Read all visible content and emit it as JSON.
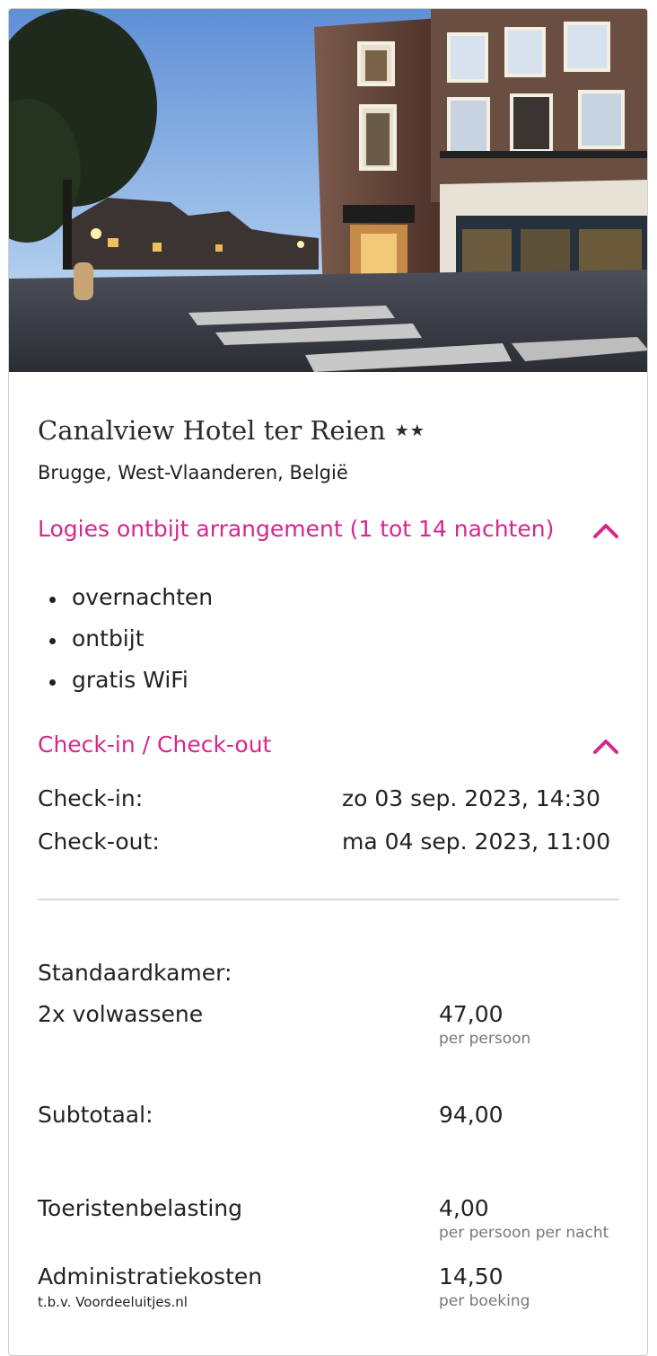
{
  "hotel": {
    "name": "Canalview Hotel ter Reien",
    "stars": "★★",
    "location": "Brugge, West-Vlaanderen, België"
  },
  "package": {
    "title": "Logies ontbijt arrangement (1 tot 14 nachten)",
    "features": [
      "overnachten",
      "ontbijt",
      "gratis WiFi"
    ]
  },
  "checkin": {
    "title": "Check-in / Check-out",
    "checkin_label": "Check-in:",
    "checkin_value": "zo 03 sep. 2023, 14:30",
    "checkout_label": "Check-out:",
    "checkout_value": "ma 04 sep. 2023, 11:00"
  },
  "pricing": {
    "room_type": "Standaardkamer:",
    "adults_label": "2x volwassene",
    "adults_price": "47,00",
    "adults_unit": "per persoon",
    "subtotal_label": "Subtotaal:",
    "subtotal_value": "94,00",
    "tax_label": "Toeristenbelasting",
    "tax_price": "4,00",
    "tax_unit": "per persoon per nacht",
    "admin_label": "Administratiekosten",
    "admin_sublabel": "t.b.v. Voordeeluitjes.nl",
    "admin_price": "14,50",
    "admin_unit": "per boeking"
  },
  "colors": {
    "accent": "#d4288b",
    "text": "#222222",
    "muted": "#777777",
    "divider": "#d9d9d9"
  },
  "icons": {
    "section_toggle": "chevron-up-icon"
  }
}
